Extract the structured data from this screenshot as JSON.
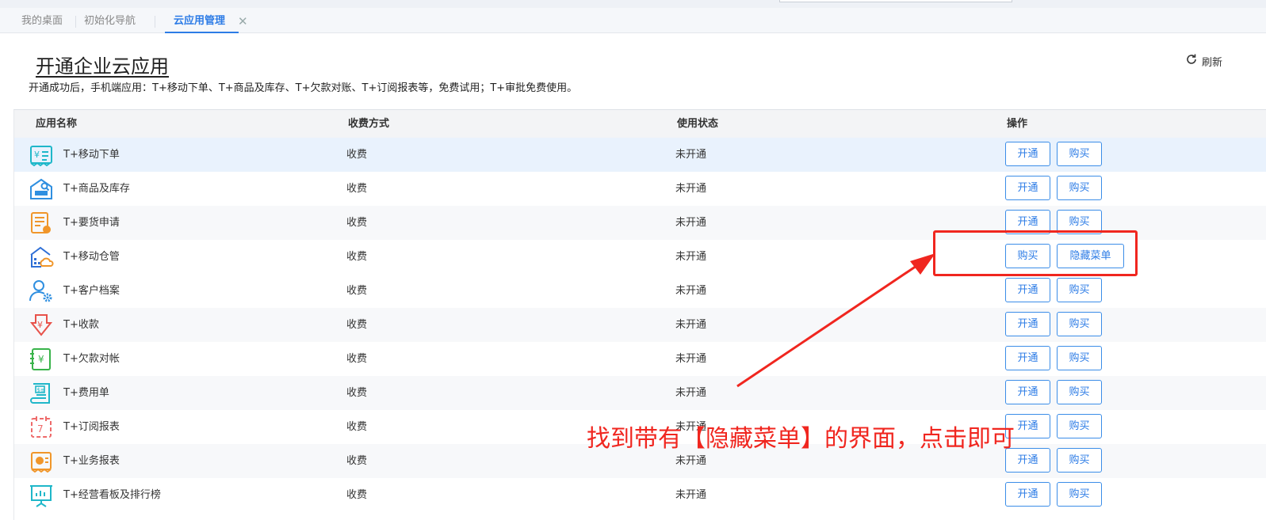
{
  "tabs": [
    {
      "label": "我的桌面"
    },
    {
      "label": "初始化导航"
    },
    {
      "label": "云应用管理",
      "active": true
    }
  ],
  "tab_close_glyph": "✕",
  "page": {
    "title": "开通企业云应用",
    "subtitle": "开通成功后，手机端应用：T+移动下单、T+商品及库存、T+欠款对账、T+订阅报表等，免费试用；T+审批免费使用。",
    "refresh_label": "刷新"
  },
  "table": {
    "headers": {
      "name": "应用名称",
      "charge": "收费方式",
      "status": "使用状态",
      "ops": "操作"
    },
    "rows": [
      {
        "name": "T+移动下单",
        "charge": "收费",
        "status": "未开通",
        "btn1": "开通",
        "btn2": "购买",
        "icon": "receipt-yen-icon"
      },
      {
        "name": "T+商品及库存",
        "charge": "收费",
        "status": "未开通",
        "btn1": "开通",
        "btn2": "购买",
        "icon": "warehouse-search-icon"
      },
      {
        "name": "T+要货申请",
        "charge": "收费",
        "status": "未开通",
        "btn1": "开通",
        "btn2": "购买",
        "icon": "request-form-icon"
      },
      {
        "name": "T+移动仓管",
        "charge": "收费",
        "status": "未开通",
        "btn1": "购买",
        "btn2": "隐藏菜单",
        "icon": "cloud-warehouse-icon"
      },
      {
        "name": "T+客户档案",
        "charge": "收费",
        "status": "未开通",
        "btn1": "开通",
        "btn2": "购买",
        "icon": "user-gear-icon"
      },
      {
        "name": "T+收款",
        "charge": "收费",
        "status": "未开通",
        "btn1": "开通",
        "btn2": "购买",
        "icon": "yen-shield-icon"
      },
      {
        "name": "T+欠款对帐",
        "charge": "收费",
        "status": "未开通",
        "btn1": "开通",
        "btn2": "购买",
        "icon": "yen-ledger-icon"
      },
      {
        "name": "T+费用单",
        "charge": "收费",
        "status": "未开通",
        "btn1": "开通",
        "btn2": "购买",
        "icon": "dollar-scroll-icon"
      },
      {
        "name": "T+订阅报表",
        "charge": "收费",
        "status": "未开通",
        "btn1": "开通",
        "btn2": "购买",
        "icon": "subscribe-report-icon"
      },
      {
        "name": "T+业务报表",
        "charge": "收费",
        "status": "未开通",
        "btn1": "开通",
        "btn2": "购买",
        "icon": "pie-report-icon"
      },
      {
        "name": "T+经营看板及排行榜",
        "charge": "收费",
        "status": "未开通",
        "btn1": "开通",
        "btn2": "购买",
        "icon": "board-chart-icon"
      }
    ]
  },
  "annotation": {
    "text": "找到带有【隐藏菜单】的界面，点击即可",
    "color": "#f0261f"
  },
  "colors": {
    "accent": "#2d7ce6",
    "annotation": "#f0261f"
  }
}
